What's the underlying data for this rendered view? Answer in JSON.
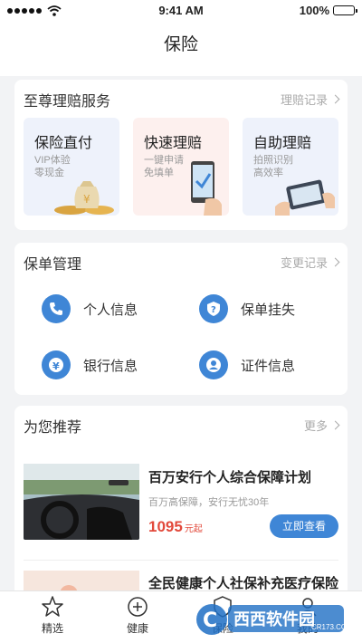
{
  "status": {
    "time": "9:41 AM",
    "battery": "100%",
    "icons": [
      "signal-icon",
      "wifi-icon",
      "battery-icon"
    ]
  },
  "nav": {
    "title": "保险"
  },
  "claims": {
    "title": "至尊理赔服务",
    "link": "理赔记录",
    "items": [
      {
        "title": "保险直付",
        "sub1": "VIP体验",
        "sub2": "零现金",
        "bg": "#eef2fb",
        "icon": "money-bag-icon"
      },
      {
        "title": "快速理赔",
        "sub1": "一键申请",
        "sub2": "免填单",
        "bg": "#fdf0ee",
        "icon": "phone-check-icon"
      },
      {
        "title": "自助理赔",
        "sub1": "拍照识别",
        "sub2": "高效率",
        "bg": "#eef2fb",
        "icon": "photo-id-icon"
      }
    ]
  },
  "policy": {
    "title": "保单管理",
    "link": "变更记录",
    "items": [
      {
        "label": "个人信息",
        "icon": "phone-icon"
      },
      {
        "label": "保单挂失",
        "icon": "question-shield-icon"
      },
      {
        "label": "银行信息",
        "icon": "yen-icon"
      },
      {
        "label": "证件信息",
        "icon": "user-icon"
      }
    ]
  },
  "recommend": {
    "title": "为您推荐",
    "link": "更多",
    "items": [
      {
        "title": "百万安行个人综合保障计划",
        "sub": "百万高保障，安行无忧30年",
        "price": "1095",
        "unit": "元起",
        "button": "立即查看"
      },
      {
        "title": "全民健康个人社保补充医疗保险"
      }
    ]
  },
  "tabs": [
    {
      "label": "精选",
      "icon": "star-icon"
    },
    {
      "label": "健康",
      "icon": "health-plus-icon"
    },
    {
      "label": "保险",
      "icon": "shield-icon"
    },
    {
      "label": "我的",
      "icon": "person-icon"
    }
  ],
  "watermark": {
    "brand": "西西软件园",
    "url": "CR173.COM"
  },
  "colors": {
    "accent": "#3f86d6",
    "price": "#e2493b",
    "background": "#f2f3f5"
  }
}
